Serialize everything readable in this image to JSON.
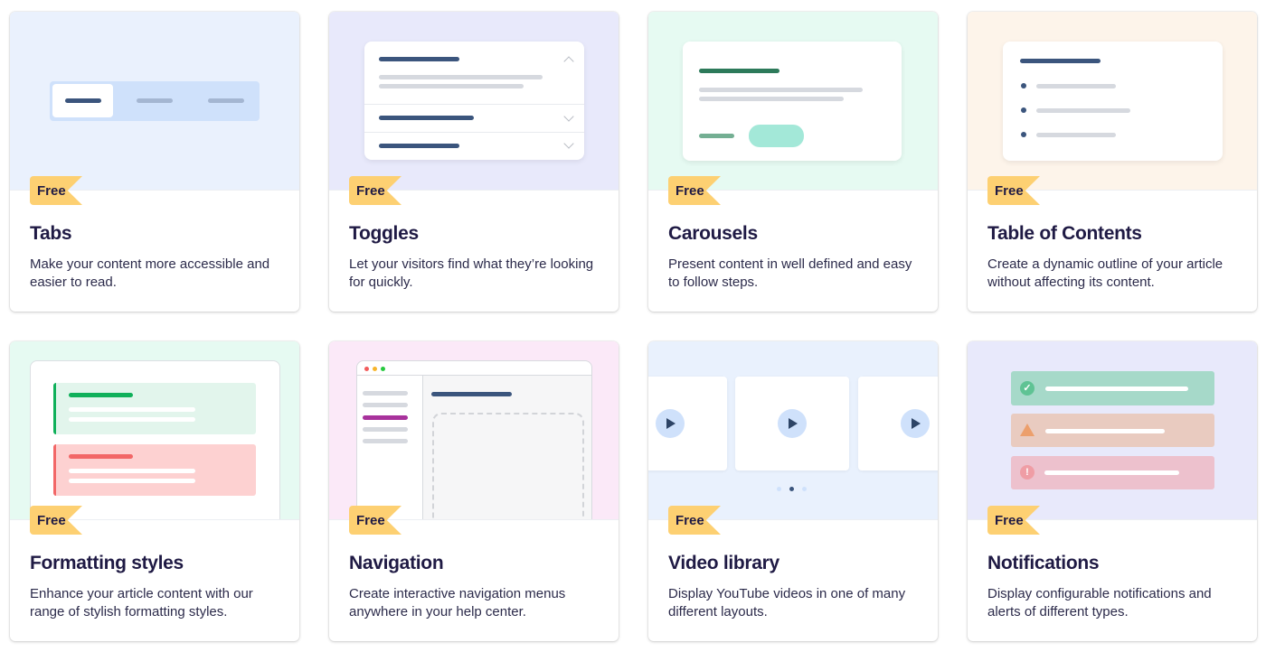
{
  "badge_label": "Free",
  "cards": [
    {
      "id": "tabs",
      "title": "Tabs",
      "description": "Make your content more accessible and easier to read.",
      "badge": "Free",
      "preview_bg": "#eaf1fd"
    },
    {
      "id": "toggles",
      "title": "Toggles",
      "description": "Let your visitors find what they’re looking for quickly.",
      "badge": "Free",
      "preview_bg": "#e8e9fb"
    },
    {
      "id": "carousels",
      "title": "Carousels",
      "description": "Present content in well defined and easy to follow steps.",
      "badge": "Free",
      "preview_bg": "#e6faf2"
    },
    {
      "id": "table-of-contents",
      "title": "Table of Contents",
      "description": "Create a dynamic outline of your article without affecting its content.",
      "badge": "Free",
      "preview_bg": "#fdf4ea"
    },
    {
      "id": "formatting-styles",
      "title": "Formatting styles",
      "description": "Enhance your article content with our range of stylish formatting styles.",
      "badge": "Free",
      "preview_bg": "#e6faf2"
    },
    {
      "id": "navigation",
      "title": "Navigation",
      "description": "Create interactive navigation menus anywhere in your help center.",
      "badge": "Free",
      "preview_bg": "#fbe9f8"
    },
    {
      "id": "video-library",
      "title": "Video library",
      "description": "Display YouTube videos in one of many different layouts.",
      "badge": "Free",
      "preview_bg": "#e9f1fd"
    },
    {
      "id": "notifications",
      "title": "Notifications",
      "description": "Display configurable notifications and alerts of different types.",
      "badge": "Free",
      "preview_bg": "#e8e9fb"
    }
  ],
  "colors": {
    "badge": "#fdd072",
    "title_text": "#1f1a44",
    "navy_bar": "#3b557d",
    "gray_bar": "#d6d9df",
    "success": "#a6d9c9",
    "warning": "#e9cbc0",
    "error": "#edc1cd",
    "nav_active": "#a8329c"
  },
  "video_library": {
    "active_page": 2,
    "page_count": 3
  }
}
